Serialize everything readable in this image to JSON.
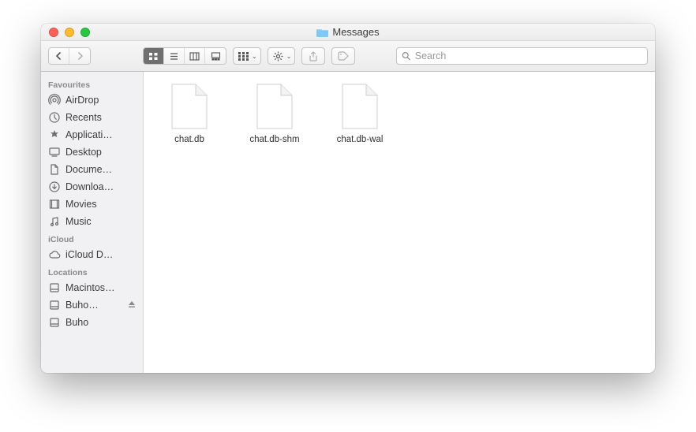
{
  "window": {
    "title": "Messages"
  },
  "search": {
    "placeholder": "Search",
    "value": ""
  },
  "sidebar": {
    "groups": [
      {
        "header": "Favourites",
        "items": [
          {
            "icon": "airdrop",
            "label": "AirDrop"
          },
          {
            "icon": "recents",
            "label": "Recents"
          },
          {
            "icon": "applications",
            "label": "Applicati…"
          },
          {
            "icon": "desktop",
            "label": "Desktop"
          },
          {
            "icon": "documents",
            "label": "Docume…"
          },
          {
            "icon": "downloads",
            "label": "Downloa…"
          },
          {
            "icon": "movies",
            "label": "Movies"
          },
          {
            "icon": "music",
            "label": "Music"
          }
        ]
      },
      {
        "header": "iCloud",
        "items": [
          {
            "icon": "cloud",
            "label": "iCloud D…"
          }
        ]
      },
      {
        "header": "Locations",
        "items": [
          {
            "icon": "disk",
            "label": "Macintos…"
          },
          {
            "icon": "disk",
            "label": "Buho…",
            "eject": true
          },
          {
            "icon": "disk",
            "label": "Buho"
          }
        ]
      }
    ]
  },
  "files": [
    {
      "name": "chat.db"
    },
    {
      "name": "chat.db-shm"
    },
    {
      "name": "chat.db-wal"
    }
  ]
}
